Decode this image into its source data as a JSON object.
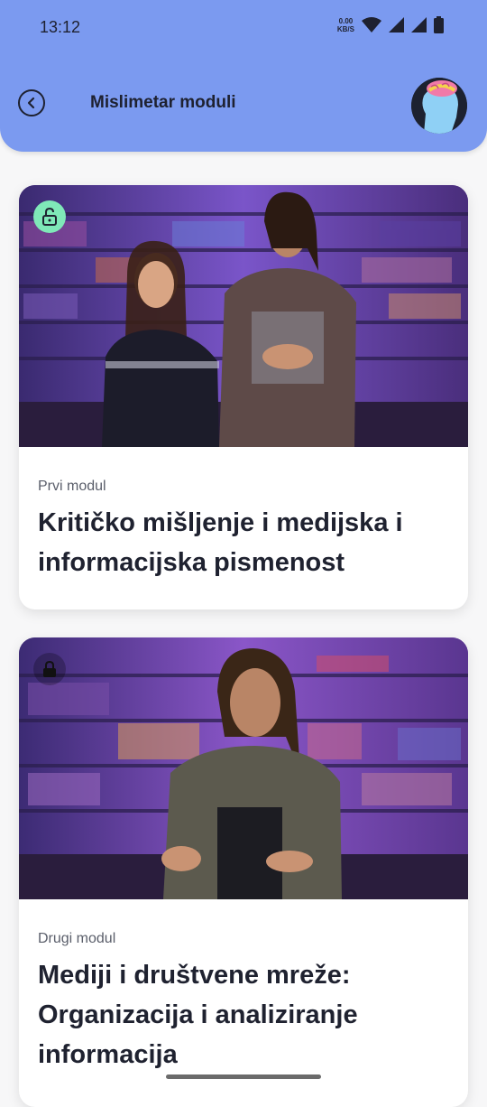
{
  "status_bar": {
    "time": "13:12",
    "net_speed_value": "0.00",
    "net_speed_unit": "KB/S"
  },
  "header": {
    "title": "Mislimetar moduli",
    "back_icon": "chevron-left-icon",
    "avatar_icon": "brain-head-avatar"
  },
  "modules": [
    {
      "label": "Prvi modul",
      "title": "Kritičko mišljenje i medijska i informacijska pismenost",
      "lock": "unlocked"
    },
    {
      "label": "Drugi modul",
      "title": "Mediji i društvene mreže: Organizacija i analiziranje informacija",
      "lock": "locked"
    }
  ],
  "colors": {
    "header_bg": "#7b9af0",
    "unlock_badge": "#7fe8b8",
    "text_dark": "#1f2230"
  }
}
